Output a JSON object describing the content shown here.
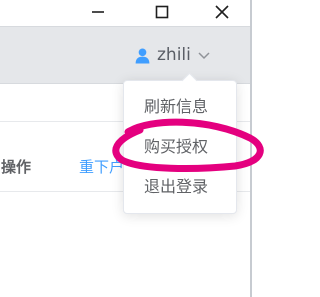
{
  "window_controls": {
    "icons": [
      "minimize-icon",
      "maximize-icon",
      "close-icon"
    ]
  },
  "header": {
    "user": {
      "icon": "user-icon",
      "name": "zhili",
      "dropdown_icon": "chevron-down-icon",
      "accent_color": "#409eff"
    }
  },
  "table": {
    "operation_header": "操作",
    "redownload_link": "重下户"
  },
  "dropdown": {
    "items": [
      {
        "label": "刷新信息"
      },
      {
        "label": "购买授权"
      },
      {
        "label": "退出登录"
      }
    ]
  },
  "annotation": {
    "shape": "hand-drawn-circle",
    "color": "#e4007f",
    "target": "购买授权"
  }
}
